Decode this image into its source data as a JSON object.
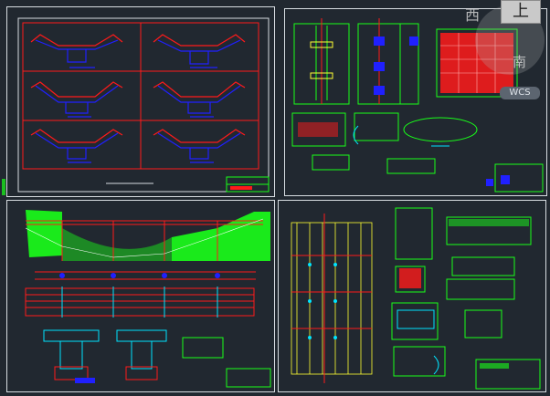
{
  "viewcube": {
    "face_label": "上",
    "west_label": "西",
    "south_label": "南",
    "ucs_label": "WCS"
  },
  "colors": {
    "background": "#212830",
    "frame": "#d8dde2",
    "red": "#ff1a1a",
    "green": "#19ff19",
    "blue": "#2020ff",
    "cyan": "#00e5ff",
    "yellow": "#ffff33",
    "white": "#ffffff"
  },
  "sheets": [
    {
      "name": "sheet-top-left",
      "content": "cross-sections"
    },
    {
      "name": "sheet-top-right",
      "content": "pier-details"
    },
    {
      "name": "sheet-bottom-left",
      "content": "elevation-plan"
    },
    {
      "name": "sheet-bottom-right",
      "content": "reinforcement"
    }
  ]
}
